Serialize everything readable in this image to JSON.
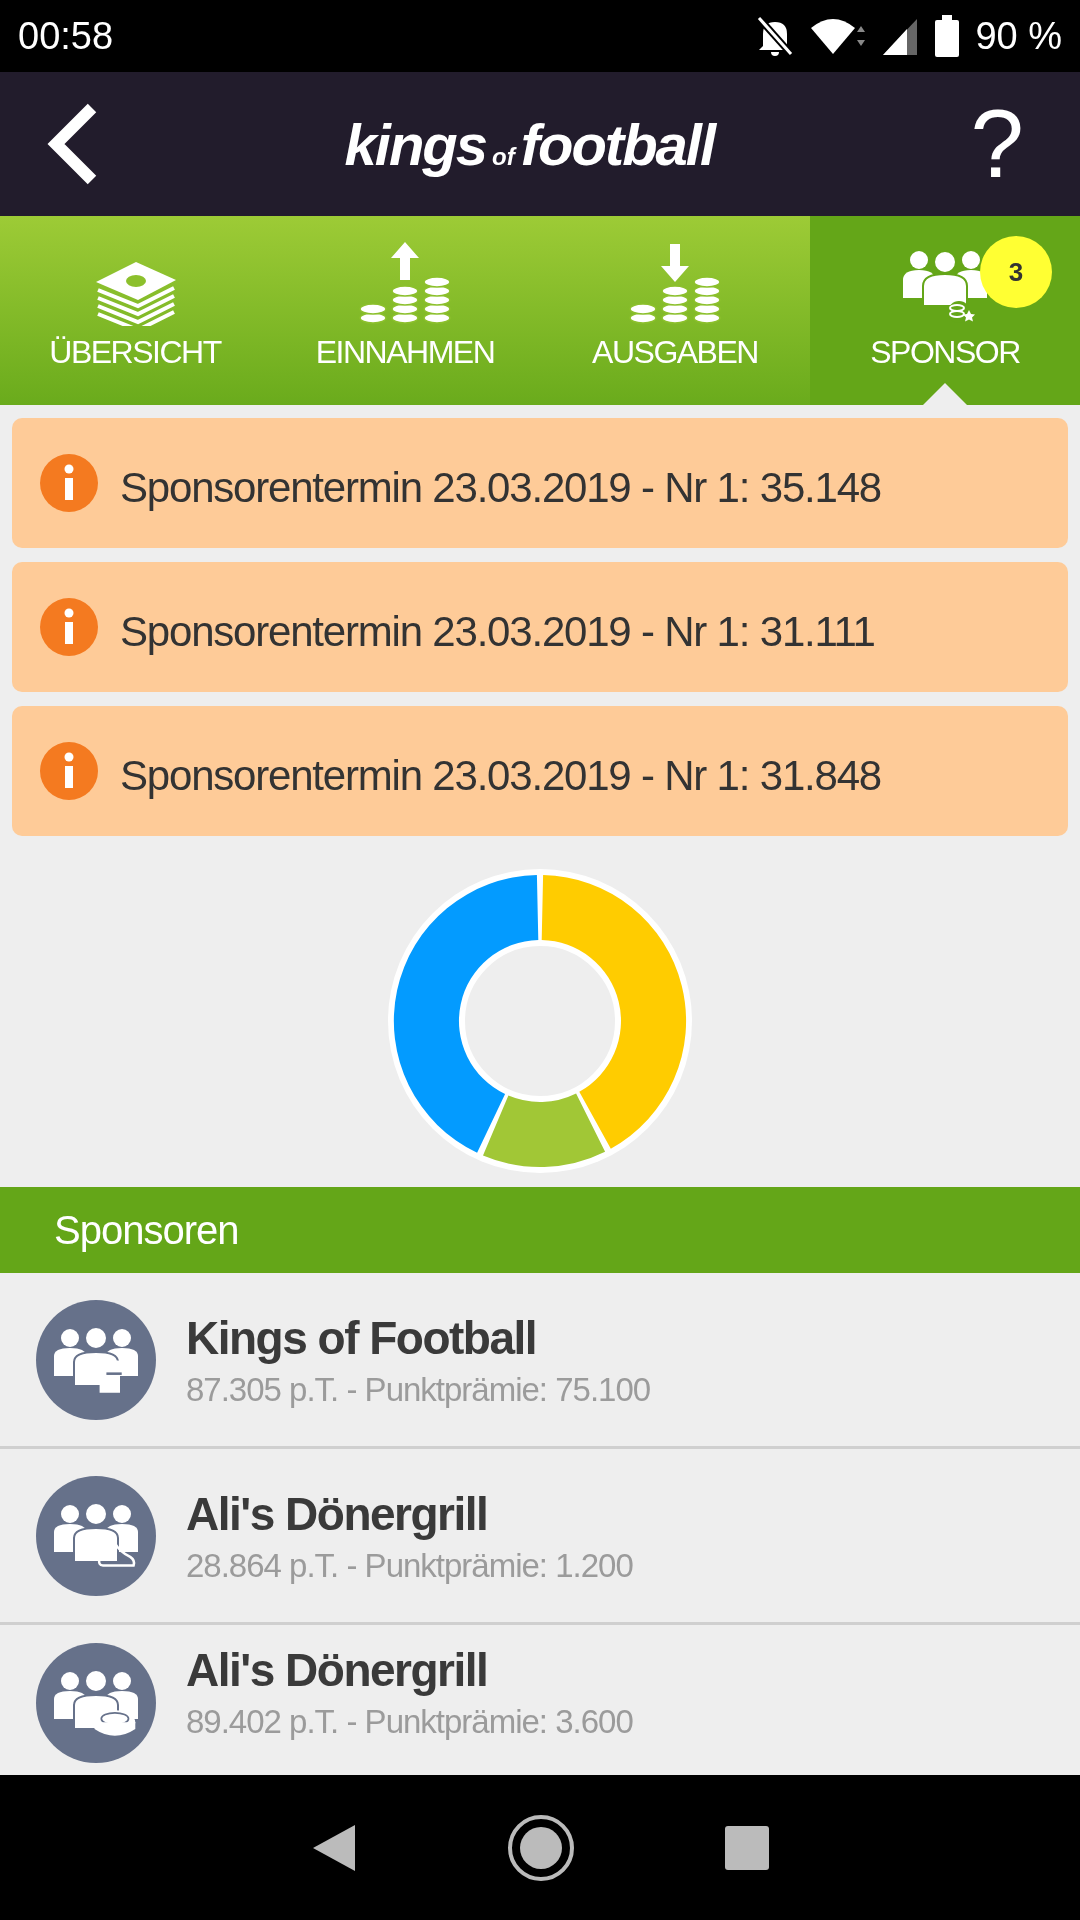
{
  "status_bar": {
    "time": "00:58",
    "battery": "90 %"
  },
  "header": {
    "logo": [
      "kings",
      "of",
      "football"
    ],
    "help": "?"
  },
  "tabs": [
    {
      "label": "ÜBERSICHT",
      "selected": false
    },
    {
      "label": "EINNAHMEN",
      "selected": false
    },
    {
      "label": "AUSGABEN",
      "selected": false
    },
    {
      "label": "SPONSOR",
      "selected": true,
      "badge": "3"
    }
  ],
  "notices": [
    {
      "text": "Sponsorentermin 23.03.2019 - Nr 1: 35.148"
    },
    {
      "text": "Sponsorentermin 23.03.2019 - Nr 1: 31.111"
    },
    {
      "text": "Sponsorentermin 23.03.2019 - Nr 1: 31.848"
    }
  ],
  "section_title": "Sponsoren",
  "sponsors": [
    {
      "name": "Kings of Football",
      "details": "87.305 p.T. - Punktprämie: 75.100"
    },
    {
      "name": "Ali's Dönergrill",
      "details": "28.864 p.T. - Punktprämie: 1.200"
    },
    {
      "name": "Ali's Dönergrill",
      "details": "89.402 p.T. - Punktprämie: 3.600"
    }
  ]
}
